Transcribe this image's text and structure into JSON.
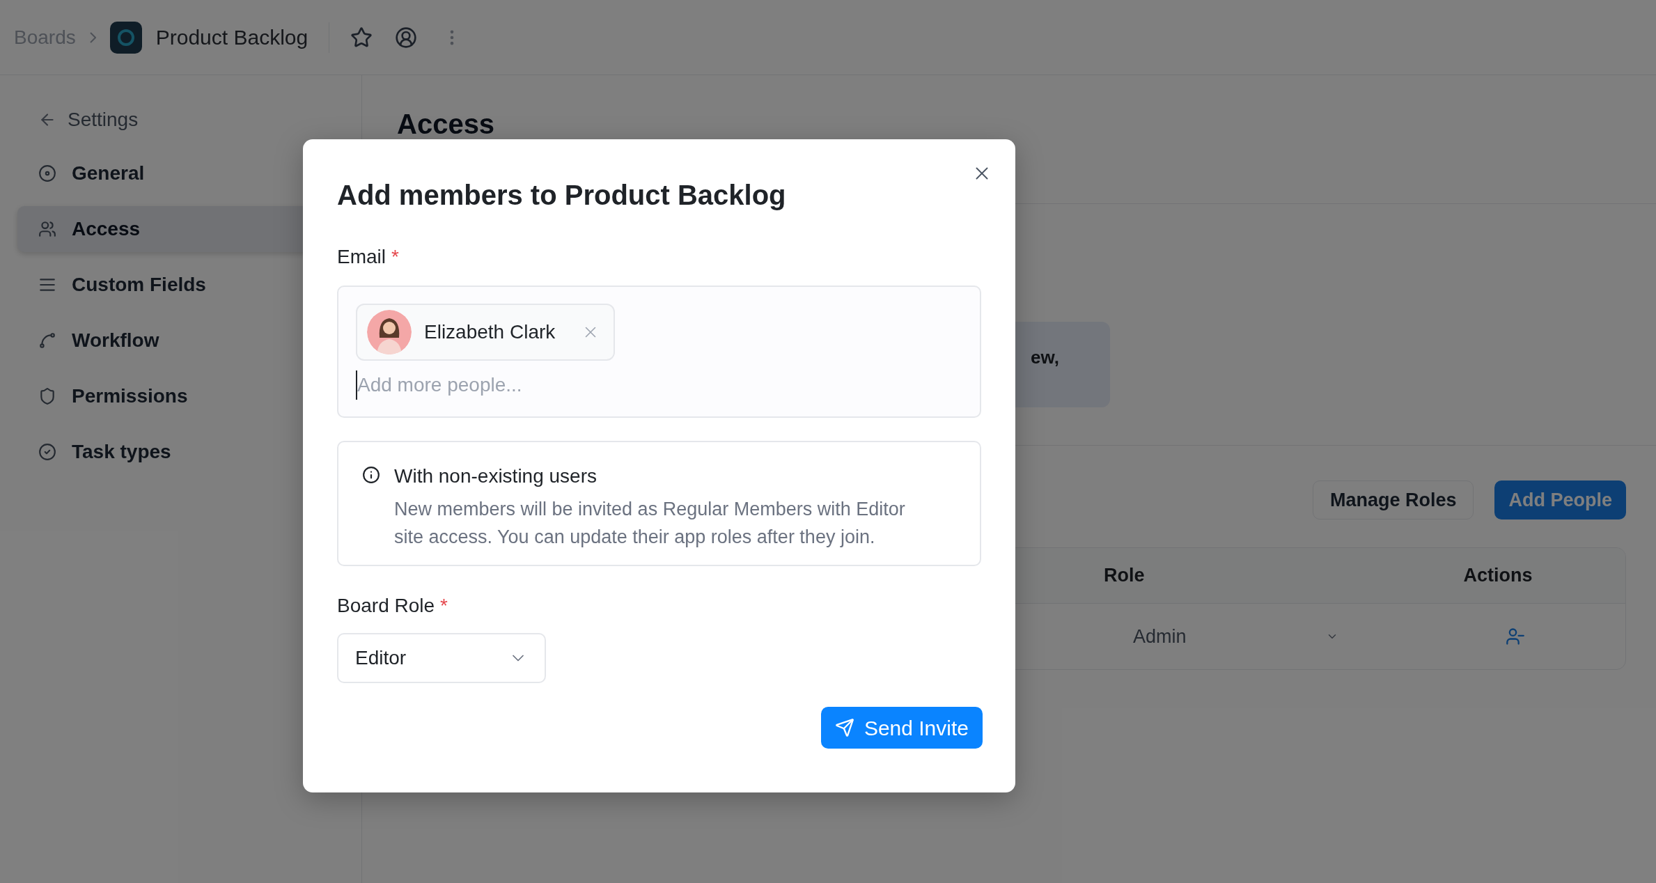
{
  "breadcrumb": {
    "parent": "Boards",
    "board": "Product Backlog"
  },
  "sidebar": {
    "back_label": "Settings",
    "items": [
      {
        "label": "General",
        "selected": false
      },
      {
        "label": "Access",
        "selected": true
      },
      {
        "label": "Custom Fields",
        "selected": false
      },
      {
        "label": "Workflow",
        "selected": false
      },
      {
        "label": "Permissions",
        "selected": false
      },
      {
        "label": "Task types",
        "selected": false
      }
    ]
  },
  "page": {
    "title": "Access",
    "notice_fragment": "ew,",
    "buttons": [
      "Manage Roles",
      "Add People"
    ],
    "table": {
      "columns": [
        "Role",
        "Actions"
      ],
      "rows": [
        {
          "role": "Admin"
        }
      ]
    }
  },
  "dialog": {
    "title": "Add members to **Product Backlog**",
    "email": {
      "label": "Email",
      "required_mark": "*",
      "chips": [
        {
          "name": "Elizabeth Clark"
        }
      ],
      "placeholder": "Add more people..."
    },
    "info": {
      "title": "With non-existing users",
      "body": "New members will be invited as Regular Members with Editor site access. You can update their app roles after they join."
    },
    "role": {
      "label": "Board Role",
      "required_mark": "*",
      "value": "Editor"
    },
    "submit": "Send Invite"
  }
}
